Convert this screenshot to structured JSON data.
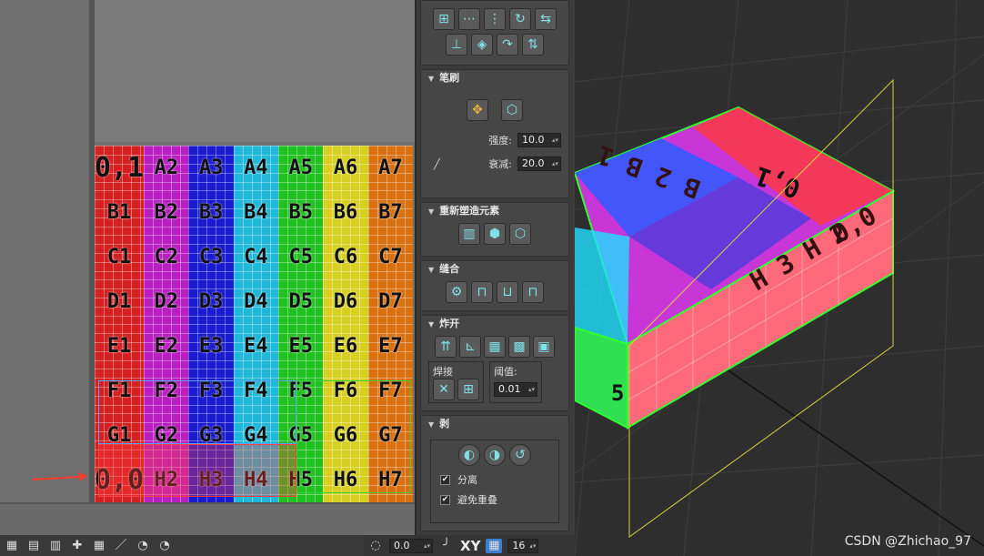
{
  "uv_grid": {
    "rows": [
      [
        "0,1",
        "A2",
        "A3",
        "A4",
        "A5",
        "A6",
        "A7"
      ],
      [
        "B1",
        "B2",
        "B3",
        "B4",
        "B5",
        "B6",
        "B7"
      ],
      [
        "C1",
        "C2",
        "C3",
        "C4",
        "C5",
        "C6",
        "C7"
      ],
      [
        "D1",
        "D2",
        "D3",
        "D4",
        "D5",
        "D6",
        "D7"
      ],
      [
        "E1",
        "E2",
        "E3",
        "E4",
        "E5",
        "E6",
        "E7"
      ],
      [
        "F1",
        "F2",
        "F3",
        "F4",
        "F5",
        "F6",
        "F7"
      ],
      [
        "G1",
        "G2",
        "G3",
        "G4",
        "G5",
        "G6",
        "G7"
      ],
      [
        "0,0",
        "H2",
        "H3",
        "H4",
        "H5",
        "H6",
        "H7"
      ]
    ],
    "column_colors": [
      "#d42020",
      "#b81ec0",
      "#1a1ad0",
      "#20b8d8",
      "#20c020",
      "#d8d020",
      "#d87010"
    ]
  },
  "panels": {
    "brush": {
      "title": "笔刷",
      "strength_label": "强度:",
      "strength_value": "10.0",
      "falloff_label": "衰减:",
      "falloff_value": "20.0"
    },
    "reshape": {
      "title": "重新塑造元素"
    },
    "stitch": {
      "title": "缝合"
    },
    "explode": {
      "title": "炸开",
      "weld_label": "焊接",
      "threshold_label": "阈值:",
      "threshold_value": "0.01"
    },
    "peel": {
      "title": "剥",
      "detach_label": "分离",
      "avoid_overlap_label": "避免重叠"
    }
  },
  "status": {
    "rotate_value": "0.0",
    "axis_label": "XY",
    "grid_value": "16"
  },
  "watermark": "CSDN @Zhichao_97",
  "colors": {
    "selection_blue": "#5aa0ff",
    "selection_red": "#ff4040",
    "accent_cyan": "#7fe0e6"
  }
}
